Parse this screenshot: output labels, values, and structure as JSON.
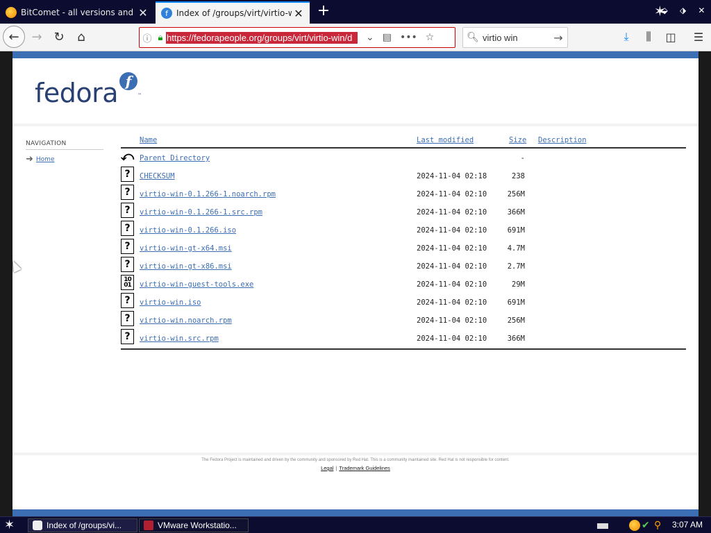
{
  "browser": {
    "tabs": [
      {
        "label": "BitComet - all versions and zip pac",
        "close": "✕"
      },
      {
        "label": "Index of /groups/virt/virtio-win/di",
        "close": "✕"
      }
    ],
    "new_tab": "+",
    "url": "https://fedorapeople.org/groups/virt/virtio-win/d",
    "search_value": "virtio win",
    "icons": {
      "back": "back-arrow-icon",
      "forward": "forward-arrow-icon",
      "reload": "reload-icon",
      "home": "home-icon",
      "download": "download-icon",
      "library": "library-icon",
      "sidebar": "sidebar-icon",
      "menu": "hamburger-menu-icon"
    }
  },
  "page": {
    "logo": "fedora",
    "logo_badge": "f",
    "logo_tm": "™",
    "navigation": {
      "title": "NAVIGATION",
      "home": "Home"
    },
    "listing": {
      "headers": {
        "name": "Name",
        "modified": "Last modified",
        "size": "Size",
        "description": "Description"
      },
      "rows": [
        {
          "name": "Parent Directory",
          "modified": "",
          "size": "-",
          "icon": "parent-dir-icon"
        },
        {
          "name": "CHECKSUM",
          "modified": "2024-11-04 02:18",
          "size": "238",
          "icon": "unknown-file-icon"
        },
        {
          "name": "virtio-win-0.1.266-1.noarch.rpm",
          "modified": "2024-11-04 02:10",
          "size": "256M",
          "icon": "unknown-file-icon"
        },
        {
          "name": "virtio-win-0.1.266-1.src.rpm",
          "modified": "2024-11-04 02:10",
          "size": "366M",
          "icon": "unknown-file-icon"
        },
        {
          "name": "virtio-win-0.1.266.iso",
          "modified": "2024-11-04 02:10",
          "size": "691M",
          "icon": "unknown-file-icon"
        },
        {
          "name": "virtio-win-gt-x64.msi",
          "modified": "2024-11-04 02:10",
          "size": "4.7M",
          "icon": "unknown-file-icon"
        },
        {
          "name": "virtio-win-gt-x86.msi",
          "modified": "2024-11-04 02:10",
          "size": "2.7M",
          "icon": "unknown-file-icon"
        },
        {
          "name": "virtio-win-guest-tools.exe",
          "modified": "2024-11-04 02:10",
          "size": "29M",
          "icon": "binary-file-icon"
        },
        {
          "name": "virtio-win.iso",
          "modified": "2024-11-04 02:10",
          "size": "691M",
          "icon": "unknown-file-icon"
        },
        {
          "name": "virtio-win.noarch.rpm",
          "modified": "2024-11-04 02:10",
          "size": "256M",
          "icon": "unknown-file-icon"
        },
        {
          "name": "virtio-win.src.rpm",
          "modified": "2024-11-04 02:10",
          "size": "366M",
          "icon": "unknown-file-icon"
        }
      ]
    },
    "footer": {
      "text": "The Fedora Project is maintained and driven by the community and sponsored by Red Hat. This is a community maintained site. Red Hat is not responsible for content.",
      "legal": "Legal",
      "separator": "|",
      "trademark": "Trademark Guidelines"
    }
  },
  "taskbar": {
    "tasks": [
      {
        "label": "Index of /groups/vi..."
      },
      {
        "label": "VMware Workstatio..."
      }
    ],
    "clock": "3:07 AM"
  }
}
